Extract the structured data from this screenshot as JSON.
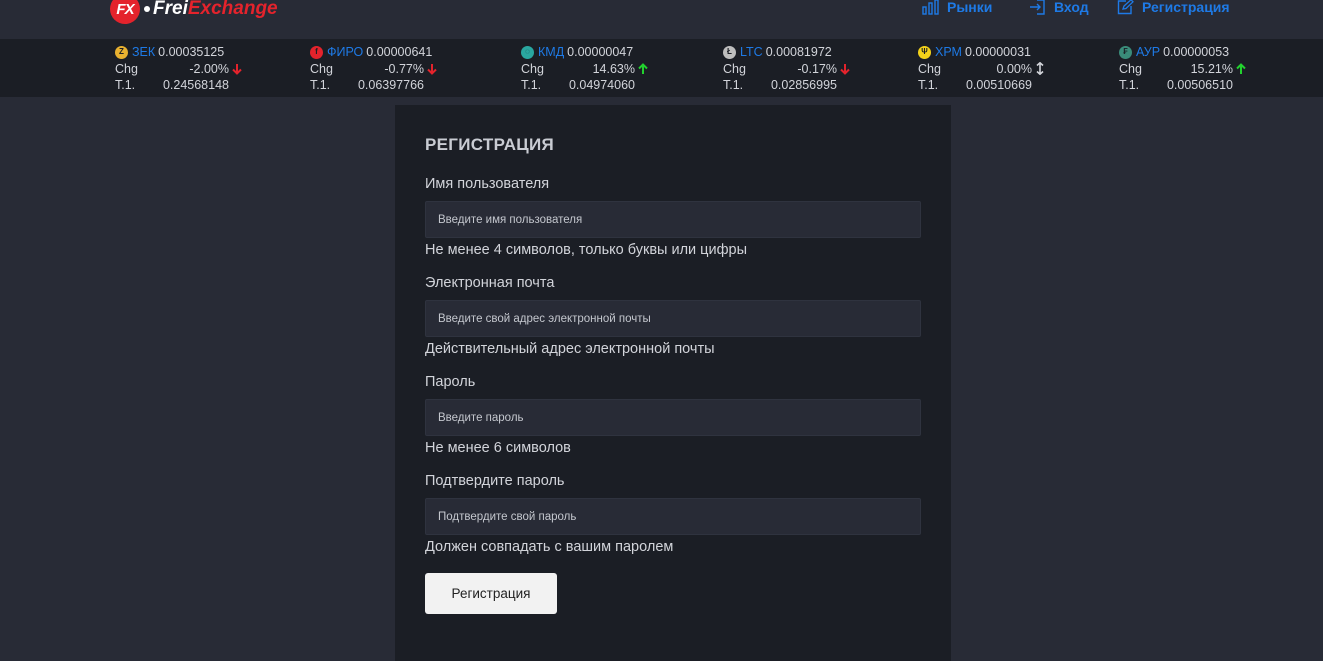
{
  "logo": {
    "badge": "FX",
    "text_a": "Frei",
    "text_b": "Exchange"
  },
  "nav": {
    "markets": "Рынки",
    "login": "Вход",
    "register": "Регистрация"
  },
  "tickers": [
    {
      "icon": "zec-coin-icon",
      "glyph": "Z",
      "color": "#e8b130",
      "symbol": "ЗЕК",
      "price": "0.00035125",
      "chg_label": "Chg",
      "chg": "-2.00%",
      "dir": "down",
      "vol_label": "T.1.",
      "vol": "0.24568148"
    },
    {
      "icon": "firo-coin-icon",
      "glyph": "f",
      "color": "#e4232c",
      "symbol": "ФИРО",
      "price": "0.00000641",
      "chg_label": "Chg",
      "chg": "-0.77%",
      "dir": "down",
      "vol_label": "T.1.",
      "vol": "0.06397766"
    },
    {
      "icon": "kmd-coin-icon",
      "glyph": "◌",
      "color": "#2aa7a0",
      "symbol": "КМД",
      "price": "0.00000047",
      "chg_label": "Chg",
      "chg": "14.63%",
      "dir": "up",
      "vol_label": "T.1.",
      "vol": "0.04974060"
    },
    {
      "icon": "ltc-coin-icon",
      "glyph": "Ł",
      "color": "#bebebe",
      "symbol": "LTC",
      "price": "0.00081972",
      "chg_label": "Chg",
      "chg": "-0.17%",
      "dir": "down",
      "vol_label": "T.1.",
      "vol": "0.02856995"
    },
    {
      "icon": "xpm-coin-icon",
      "glyph": "Ψ",
      "color": "#f3d21a",
      "symbol": "ХРМ",
      "price": "0.00000031",
      "chg_label": "Chg",
      "chg": "0.00%",
      "dir": "flat",
      "vol_label": "T.1.",
      "vol": "0.00510669"
    },
    {
      "icon": "aur-coin-icon",
      "glyph": "₣",
      "color": "#3a8c7a",
      "symbol": "АУР",
      "price": "0.00000053",
      "chg_label": "Chg",
      "chg": "15.21%",
      "dir": "up",
      "vol_label": "T.1.",
      "vol": "0.00506510"
    }
  ],
  "form": {
    "title": "РЕГИСТРАЦИЯ",
    "username": {
      "label": "Имя пользователя",
      "placeholder": "Введите имя пользователя",
      "help": "Не менее 4 символов, только буквы или цифры"
    },
    "email": {
      "label": "Электронная почта",
      "placeholder": "Введите свой адрес электронной почты",
      "help": "Действительный адрес электронной почты"
    },
    "password": {
      "label": "Пароль",
      "placeholder": "Введите пароль",
      "help": "Не менее 6 символов"
    },
    "confirm": {
      "label": "Подтвердите пароль",
      "placeholder": "Подтвердите свой пароль",
      "help": "Должен совпадать с вашим паролем"
    },
    "submit": "Регистрация"
  }
}
